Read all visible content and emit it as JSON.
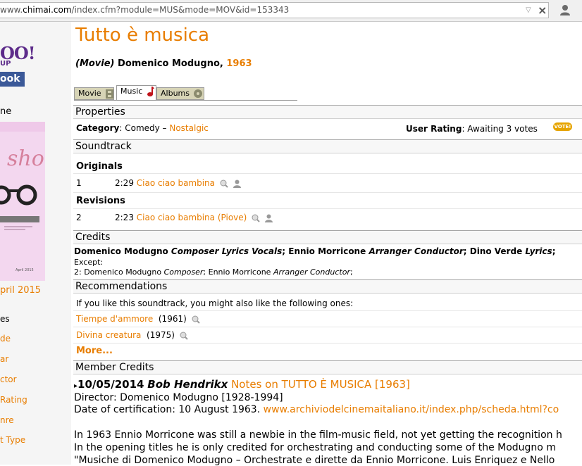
{
  "browser": {
    "url_prefix": "www.",
    "url_domain": "chimai.com",
    "url_path": "/index.cfm?module=MUS&mode=MOV&id=153343"
  },
  "sidebar": {
    "yahoo_logo": "OO!",
    "yahoo_sub": "UP",
    "facebook_logo": "ook",
    "home_label": "ne",
    "magazine_date": "April 2015",
    "april_link": "pril 2015",
    "links": [
      "es",
      "de",
      "ar",
      "ctor",
      "Rating",
      "nre",
      "t Type"
    ]
  },
  "page": {
    "title": "Tutto è musica",
    "subtitle_type": "(Movie)",
    "subtitle_artist": "Domenico Modugno,",
    "subtitle_year": "1963"
  },
  "tabs": [
    {
      "label": "Movie"
    },
    {
      "label": "Music"
    },
    {
      "label": "Albums"
    }
  ],
  "properties": {
    "heading": "Properties",
    "category_label": "Category",
    "category_value": ": Comedy – ",
    "category_link": "Nostalgic",
    "rating_label": "User Rating",
    "rating_value": ": Awaiting 3 votes",
    "vote_badge": "VOTE!"
  },
  "soundtrack": {
    "heading": "Soundtrack",
    "originals_label": "Originals",
    "revisions_label": "Revisions",
    "tracks": [
      {
        "num": "1",
        "time": "2:29",
        "title": "Ciao ciao bambina"
      },
      {
        "num": "2",
        "time": "2:23",
        "title": "Ciao ciao bambina (Piove)"
      }
    ]
  },
  "credits": {
    "heading": "Credits",
    "line1": [
      {
        "name": "Domenico Modugno",
        "role": "Composer Lyrics Vocals"
      },
      {
        "name": "Ennio Morricone",
        "role": "Arranger Conductor"
      },
      {
        "name": "Dino Verde",
        "role": "Lyrics"
      }
    ],
    "except_label": "Except:",
    "line2_prefix": "2: ",
    "line2": [
      {
        "name": "Domenico Modugno",
        "role": "Composer"
      },
      {
        "name": "Ennio Morricone",
        "role": "Arranger Conductor"
      }
    ]
  },
  "recommendations": {
    "heading": "Recommendations",
    "intro": "If you like this soundtrack, you might also like the following ones:",
    "items": [
      {
        "title": "Tiempe d'ammore",
        "year": "(1961)"
      },
      {
        "title": "Divina creatura",
        "year": "(1975)"
      }
    ],
    "more_link": "More..."
  },
  "member_credits": {
    "heading": "Member Credits",
    "date": "10/05/2014",
    "author": "Bob Hendrikx",
    "notes_link": "Notes on TUTTO È MUSICA [1963]",
    "director_line": "Director: Domenico Modugno [1928-1994]",
    "cert_label": "Date of certification: 10 August 1963. ",
    "cert_link": "www.archiviodelcinemaitaliano.it/index.php/scheda.html?co",
    "paragraph": [
      "In 1963 Ennio Morricone was still a newbie in the film-music field, not yet getting the recognition h",
      "In the opening titles he is only credited for orchestrating and conducting some of the Modugno m",
      "\"Musiche di Domenico Modugno – Orchestrate e dirette da Ennio Morricone. Luis Enriquez e Nello"
    ]
  },
  "colors": {
    "accent": "#e87d00",
    "tab_bg": "#d7d4b6",
    "facebook": "#3b5998",
    "yahoo": "#5d2c8a"
  }
}
